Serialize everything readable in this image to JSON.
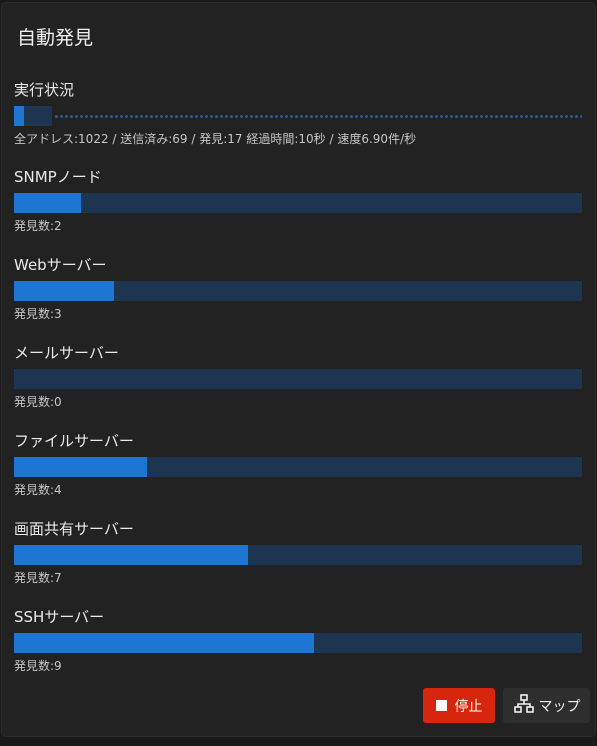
{
  "dialog": {
    "title": "自動発見"
  },
  "progress": {
    "label": "実行状況",
    "value": 0.017,
    "stats": "全アドレス:1022 / 送信済み:69 / 発見:17 経過時間:10秒 / 速度6.90件/秒"
  },
  "categories": [
    {
      "label": "SNMPノード",
      "count_text": "発見数:2",
      "value": 0.118
    },
    {
      "label": "Webサーバー",
      "count_text": "発見数:3",
      "value": 0.176
    },
    {
      "label": "メールサーバー",
      "count_text": "発見数:0",
      "value": 0.0
    },
    {
      "label": "ファイルサーバー",
      "count_text": "発見数:4",
      "value": 0.235
    },
    {
      "label": "画面共有サーバー",
      "count_text": "発見数:7",
      "value": 0.412
    },
    {
      "label": "SSHサーバー",
      "count_text": "発見数:9",
      "value": 0.529
    }
  ],
  "buttons": {
    "stop_label": "停止",
    "map_label": "マップ"
  },
  "icons": {
    "stop": "stop-square-icon",
    "map": "network-map-icon"
  },
  "colors": {
    "accent": "#1f76d2",
    "track": "#1e3552",
    "stop": "#d7260d"
  }
}
